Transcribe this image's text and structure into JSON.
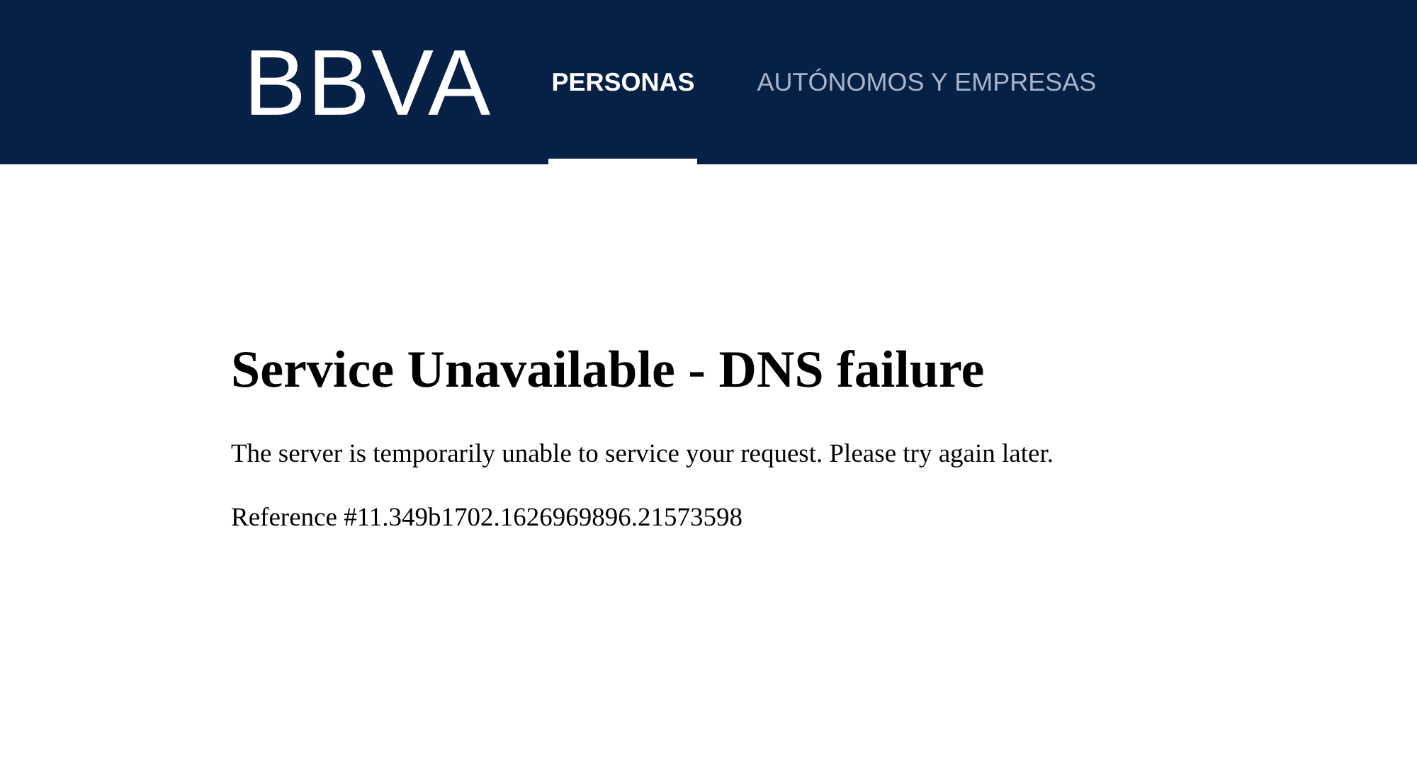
{
  "header": {
    "logo": "BBVA",
    "tabs": [
      {
        "label": "PERSONAS",
        "selected": true
      },
      {
        "label": "AUTÓNOMOS Y EMPRESAS",
        "selected": false
      }
    ]
  },
  "error": {
    "title": "Service Unavailable - DNS failure",
    "message": "The server is temporarily unable to service your request. Please try again later.",
    "reference": "Reference #11.349b1702.1626969896.21573598"
  }
}
